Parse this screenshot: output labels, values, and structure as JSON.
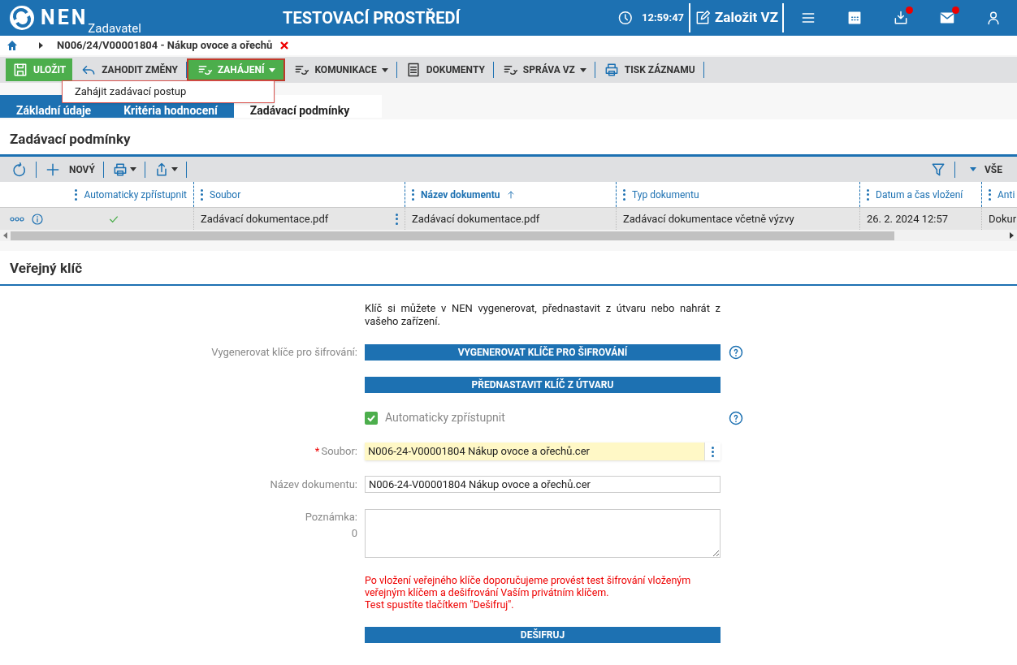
{
  "header": {
    "logo": "NEN",
    "role": "Zadavatel",
    "environment": "TESTOVACÍ PROSTŘEDÍ",
    "time": "12:59:47",
    "create_button": "Založit VZ",
    "icons": [
      {
        "kind": "menu",
        "badge": false
      },
      {
        "kind": "calendar",
        "badge": false
      },
      {
        "kind": "inbox",
        "badge": true
      },
      {
        "kind": "mail",
        "badge": true
      },
      {
        "kind": "user",
        "badge": false
      }
    ]
  },
  "breadcrumb": {
    "title": "N006/24/V00001804 - Nákup ovoce a ořechů"
  },
  "toolbar": [
    {
      "kind": "save",
      "label": "ULOŽIT",
      "selected": false
    },
    {
      "kind": "undo",
      "label": "ZAHODIT ZMĚNY",
      "selected": false
    },
    {
      "kind": "flow",
      "label": "ZAHÁJENÍ",
      "dropdown": true,
      "selected": true
    },
    {
      "kind": "flow",
      "label": "KOMUNIKACE",
      "dropdown": true,
      "selected": false
    },
    {
      "kind": "doc",
      "label": "DOKUMENTY",
      "selected": false
    },
    {
      "kind": "flow",
      "label": "SPRÁVA VZ",
      "dropdown": true,
      "selected": false
    },
    {
      "kind": "print",
      "label": "TISK ZÁZNAMU",
      "selected": false
    }
  ],
  "dropdown_menu": {
    "items": [
      "Zahájit zadávací postup"
    ]
  },
  "tabs": [
    {
      "label": "Základní údaje",
      "selected": false
    },
    {
      "label": "Kritéria hodnocení",
      "selected": false
    },
    {
      "label": "Zadávací podmínky",
      "selected": true
    }
  ],
  "conditions": {
    "title": "Zadávací podmínky",
    "new_button": "NOVÝ",
    "filter_label": "VŠE",
    "columns": [
      {
        "label": "Automaticky zpřístupnit",
        "sorted": false
      },
      {
        "label": "Soubor",
        "sorted": false
      },
      {
        "label": "Název dokumentu",
        "sorted": true
      },
      {
        "label": "Typ dokumentu",
        "sorted": false
      },
      {
        "label": "Datum a čas vložení",
        "sorted": false
      },
      {
        "label": "Anti",
        "sorted": false
      }
    ],
    "rows": [
      {
        "auto": true,
        "file": "Zadávací dokumentace.pdf",
        "name": "Zadávací dokumentace.pdf",
        "type": "Zadávací dokumentace včetně výzvy",
        "date": "26. 2. 2024 12:57",
        "column_6": "Dokur"
      }
    ]
  },
  "public_key": {
    "title": "Veřejný klíč",
    "intro": "Klíč si můžete v NEN vygenerovat, přednastavit z útvaru nebo nahrát z vašeho zařízení.",
    "generate_label": "Vygenerovat klíče pro šifrování:",
    "generate_button": "VYGENEROVAT KLÍČE PRO ŠIFROVÁNÍ",
    "preset_button": "PŘEDNASTAVIT KLÍČ Z ÚTVARU",
    "auto_label": "Automaticky zpřístupnit",
    "auto_checked": true,
    "file_label": "Soubor:",
    "file_required": true,
    "required_mark": "*",
    "file_value": "N006-24-V00001804 Nákup ovoce a ořechů.cer",
    "name_label": "Název dokumentu:",
    "name_value": "N006-24-V00001804 Nákup ovoce a ořechů.cer",
    "note_label": "Poznámka:",
    "note_count": "0",
    "warning": [
      "Po vložení veřejného klíče doporučujeme provést test šifrování vloženým veřejným klíčem a dešifrování Vaším privátním klíčem.",
      "Test spustíte tlačítkem \"Dešifruj\"."
    ],
    "decrypt_button": "DEŠIFRUJ"
  }
}
